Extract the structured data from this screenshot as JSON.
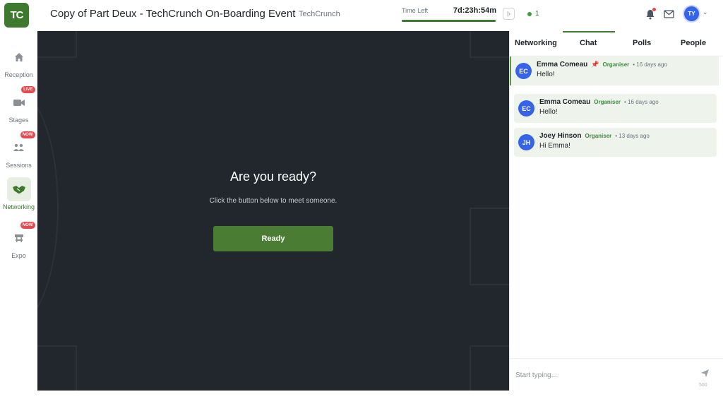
{
  "app": {
    "logo_text": "TC",
    "event_title": "Copy of Part Deux - TechCrunch On-Boarding Event",
    "org_name": "TechCrunch"
  },
  "timer": {
    "label": "Time Left",
    "value": "7d:23h:54m",
    "progress": 0.99
  },
  "header": {
    "online_count": "1",
    "avatar_initials": "TY"
  },
  "sidebar": {
    "items": [
      {
        "label": "Reception",
        "icon": "home-icon",
        "badge": ""
      },
      {
        "label": "Stages",
        "icon": "video-camera-icon",
        "badge": "LIVE"
      },
      {
        "label": "Sessions",
        "icon": "people-icon",
        "badge": "NOW"
      },
      {
        "label": "Networking",
        "icon": "handshake-icon",
        "badge": ""
      },
      {
        "label": "Expo",
        "icon": "booth-icon",
        "badge": "NOW"
      }
    ]
  },
  "stage": {
    "title": "Are you ready?",
    "subtitle": "Click the button below to meet someone.",
    "button_label": "Ready"
  },
  "panel": {
    "tabs": [
      {
        "label": "Networking"
      },
      {
        "label": "Chat"
      },
      {
        "label": "Polls"
      },
      {
        "label": "People"
      }
    ],
    "active_tab": "Chat",
    "messages": [
      {
        "initials": "EC",
        "name": "Emma Comeau",
        "role": "Organiser",
        "time": "• 16 days ago",
        "text": "Hello!",
        "pinned": true
      },
      {
        "initials": "EC",
        "name": "Emma Comeau",
        "role": "Organiser",
        "time": "• 16 days ago",
        "text": "Hello!",
        "pinned": false
      },
      {
        "initials": "JH",
        "name": "Joey Hinson",
        "role": "Organiser",
        "time": "• 13 days ago",
        "text": "Hi Emma!",
        "pinned": false
      }
    ],
    "composer": {
      "placeholder": "Start typing...",
      "char_limit": "500"
    }
  },
  "colors": {
    "brand_green": "#3d7a2f",
    "stage_bg": "#22272d",
    "avatar_blue": "#3563e9",
    "badge_red": "#e5484d"
  }
}
